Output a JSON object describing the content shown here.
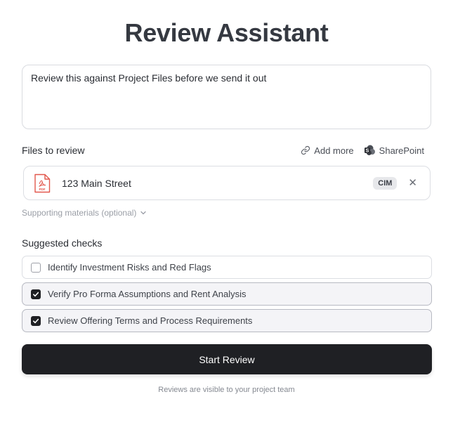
{
  "title": "Review Assistant",
  "prompt": {
    "value": "Review this against Project Files before we send it out"
  },
  "files": {
    "label": "Files to review",
    "add_more_label": "Add more",
    "sharepoint_label": "SharePoint",
    "items": [
      {
        "name": "123 Main Street",
        "badge": "CIM",
        "icon": "pdf-icon"
      }
    ]
  },
  "supporting": {
    "label": "Supporting materials (optional)"
  },
  "checks": {
    "label": "Suggested checks",
    "items": [
      {
        "label": "Identify Investment Risks and Red Flags",
        "checked": false
      },
      {
        "label": "Verify Pro Forma Assumptions and Rent Analysis",
        "checked": true
      },
      {
        "label": "Review Offering Terms and Process Requirements",
        "checked": true
      }
    ]
  },
  "start_button": {
    "label": "Start Review"
  },
  "footnote": "Reviews are visible to your project team",
  "colors": {
    "primary": "#1f2024",
    "pdf_red": "#e2574c",
    "border": "#dcdee3"
  }
}
